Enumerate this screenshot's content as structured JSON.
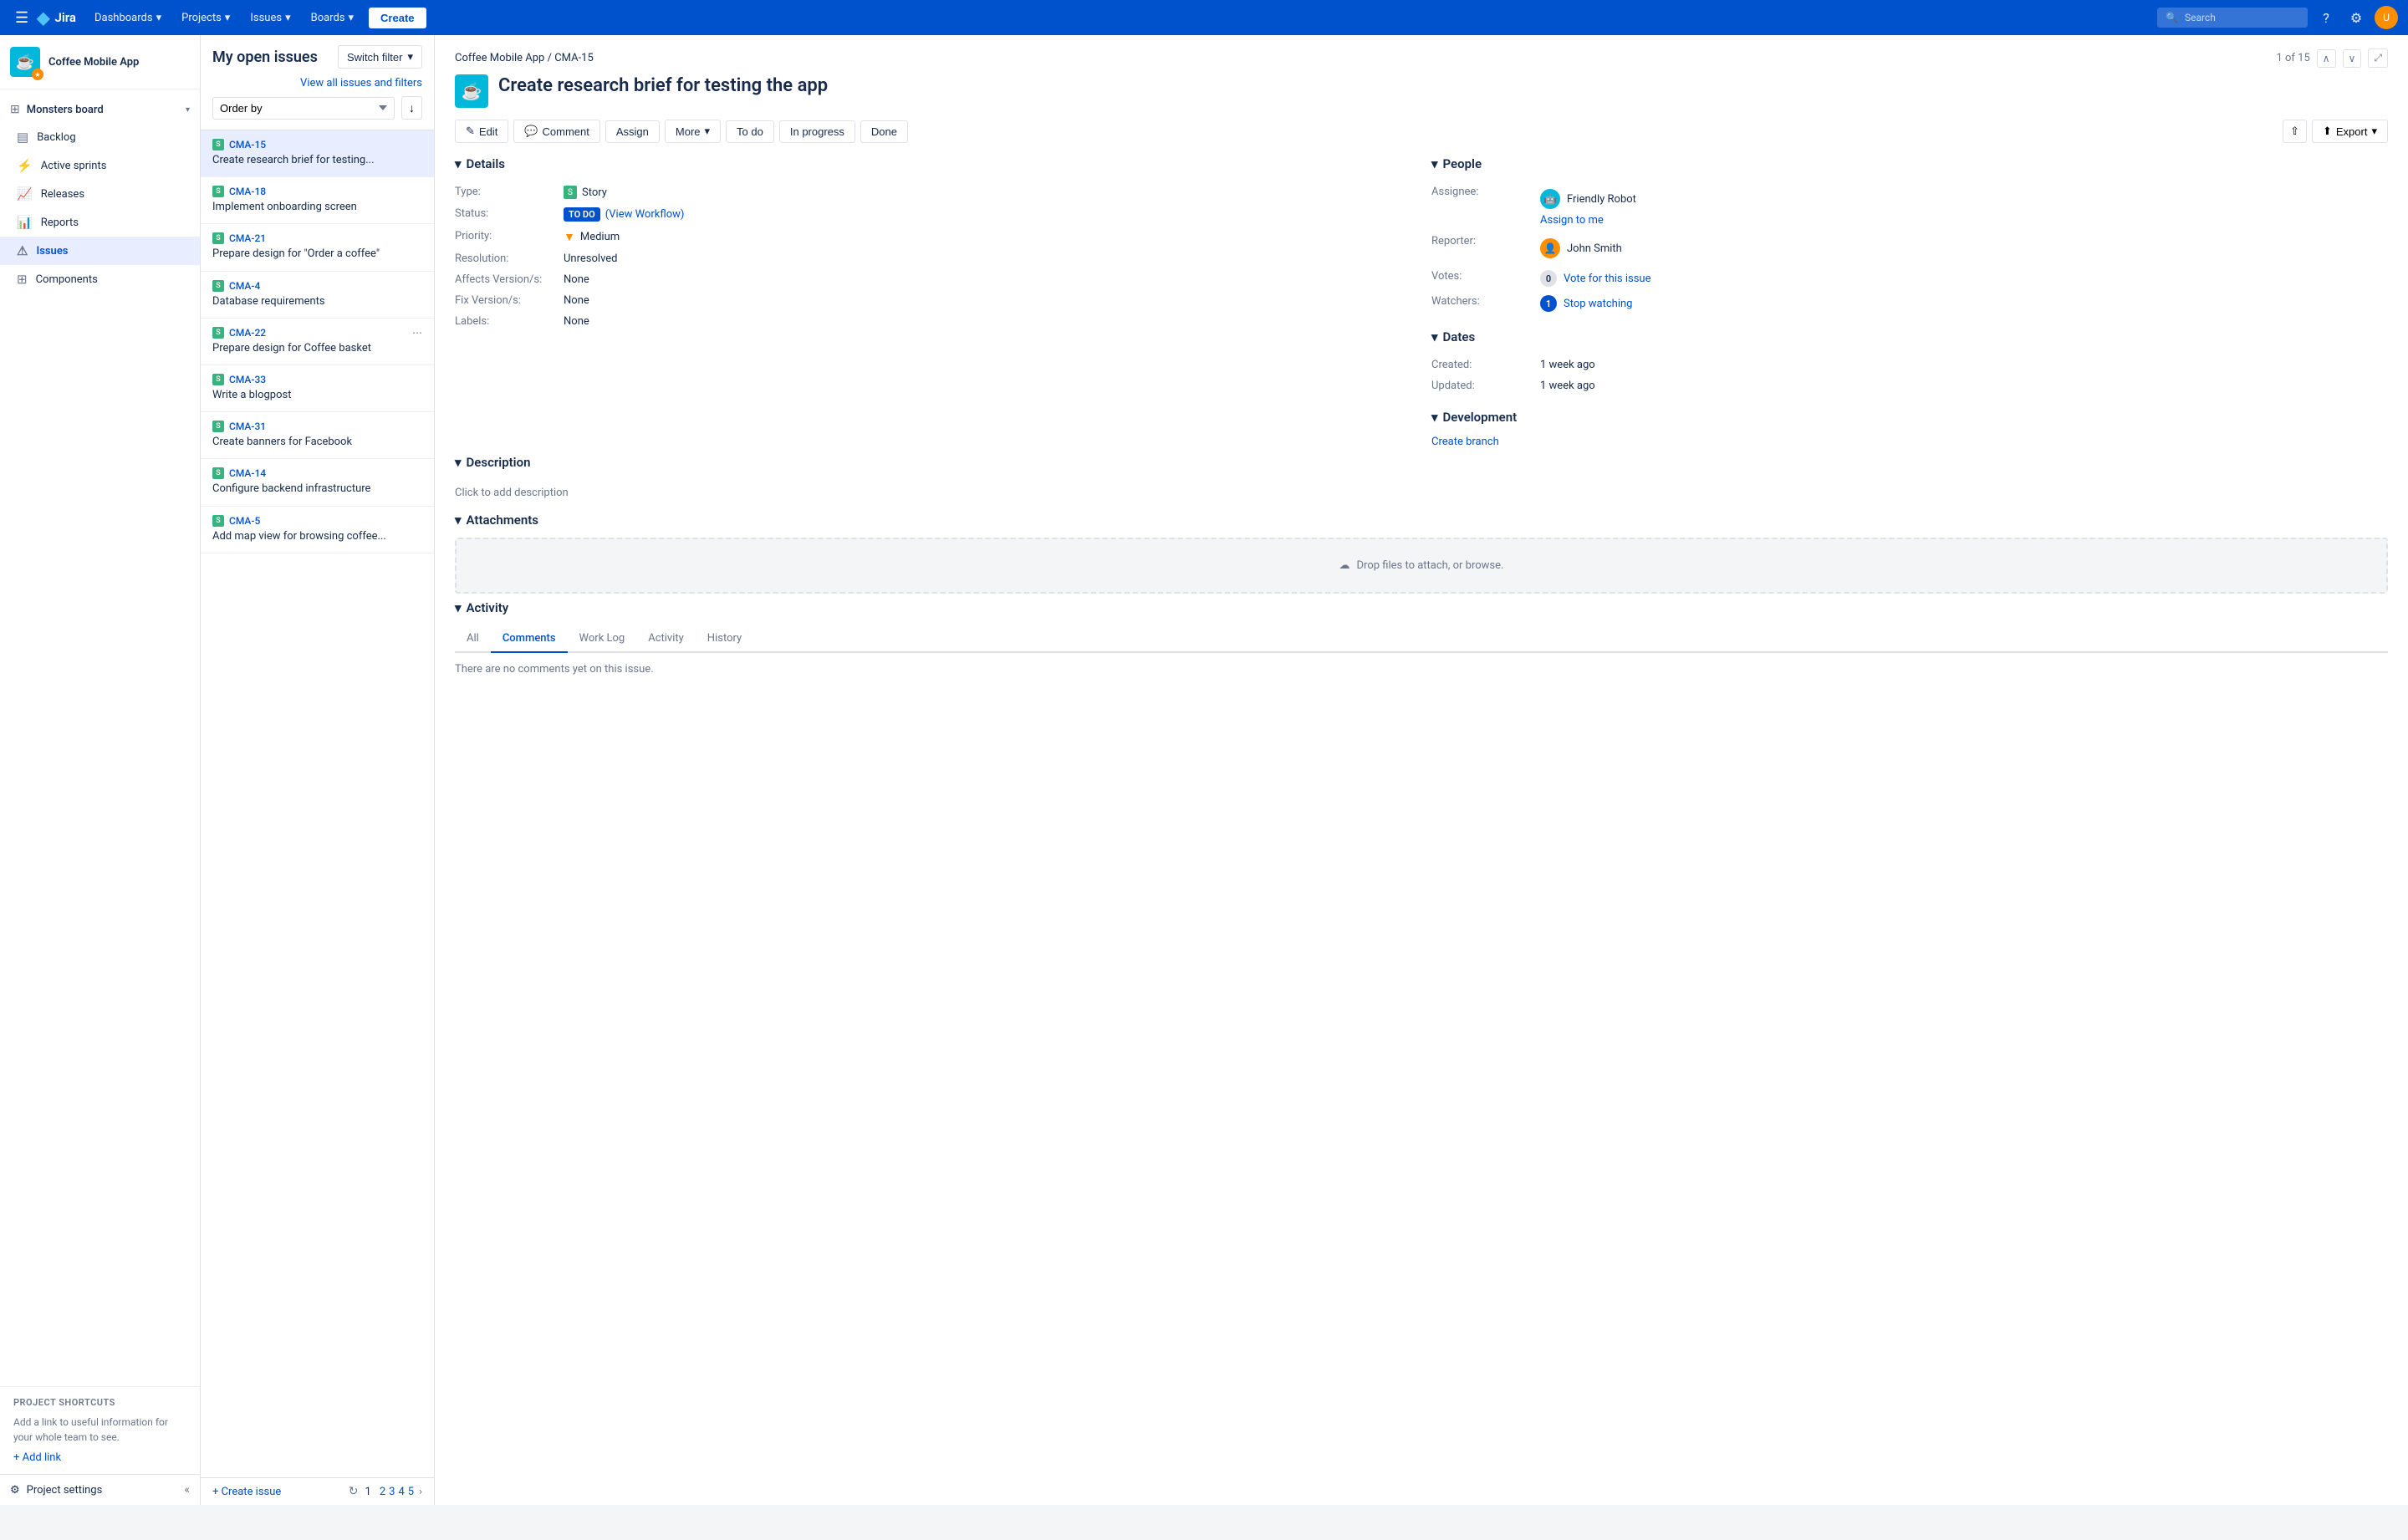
{
  "topNav": {
    "logoText": "Jira",
    "hamburger": "☰",
    "items": [
      {
        "label": "Dashboards",
        "id": "dashboards"
      },
      {
        "label": "Projects",
        "id": "projects"
      },
      {
        "label": "Issues",
        "id": "issues"
      },
      {
        "label": "Boards",
        "id": "boards"
      }
    ],
    "createLabel": "Create",
    "searchPlaceholder": "Search",
    "helpIcon": "?",
    "settingsIcon": "⚙"
  },
  "sidebar": {
    "projectName": "Coffee Mobile App",
    "boardsLabel": "Monsters board",
    "navItems": [
      {
        "label": "Backlog",
        "icon": "▤",
        "id": "backlog",
        "active": false
      },
      {
        "label": "Active sprints",
        "icon": "⚡",
        "id": "active-sprints",
        "active": false
      },
      {
        "label": "Releases",
        "icon": "📈",
        "id": "releases",
        "active": false
      },
      {
        "label": "Reports",
        "icon": "📊",
        "id": "reports",
        "active": false
      },
      {
        "label": "Issues",
        "icon": "⚠",
        "id": "issues",
        "active": true
      },
      {
        "label": "Components",
        "icon": "⊞",
        "id": "components",
        "active": false
      }
    ],
    "shortcutsTitle": "PROJECT SHORTCUTS",
    "shortcutsDesc": "Add a link to useful information for your whole team to see.",
    "addLinkLabel": "+ Add link",
    "projectSettingsLabel": "Project settings",
    "collapseIcon": "«"
  },
  "issuesList": {
    "pageTitle": "My open issues",
    "switchFilterLabel": "Switch filter",
    "viewAllLabel": "View all issues and filters",
    "orderByLabel": "Order by",
    "issues": [
      {
        "id": "CMA-15",
        "title": "Create research brief for testing...",
        "selected": true
      },
      {
        "id": "CMA-18",
        "title": "Implement onboarding screen",
        "selected": false
      },
      {
        "id": "CMA-21",
        "title": "Prepare design for \"Order a coffee\"",
        "selected": false
      },
      {
        "id": "CMA-4",
        "title": "Database requirements",
        "selected": false
      },
      {
        "id": "CMA-22",
        "title": "Prepare design for Coffee basket",
        "selected": false,
        "hasMore": true
      },
      {
        "id": "CMA-33",
        "title": "Write a blogpost",
        "selected": false
      },
      {
        "id": "CMA-31",
        "title": "Create banners for Facebook",
        "selected": false
      },
      {
        "id": "CMA-14",
        "title": "Configure backend infrastructure",
        "selected": false
      },
      {
        "id": "CMA-5",
        "title": "Add map view for browsing coffee...",
        "selected": false
      }
    ],
    "createIssueLabel": "+ Create issue",
    "pagination": {
      "current": "1",
      "pages": [
        "2",
        "3",
        "4",
        "5"
      ],
      "nextArrow": "›"
    },
    "refreshIcon": "↻"
  },
  "issueDetail": {
    "breadcrumb": "Coffee Mobile App / CMA-15",
    "breadcrumbProject": "Coffee Mobile App",
    "breadcrumbSep": " / ",
    "breadcrumbId": "CMA-15",
    "navCount": "1 of 15",
    "title": "Create research brief for testing the app",
    "actions": {
      "edit": "Edit",
      "comment": "Comment",
      "assign": "Assign",
      "more": "More",
      "todo": "To do",
      "inProgress": "In progress",
      "done": "Done",
      "share": "⇧",
      "export": "Export"
    },
    "details": {
      "sectionTitle": "Details",
      "type": "Story",
      "status": "TO DO",
      "statusSub": "(View Workflow)",
      "priority": "Medium",
      "resolution": "Unresolved",
      "affectsVersions": "None",
      "fixVersions": "None",
      "labels": "None"
    },
    "people": {
      "sectionTitle": "People",
      "assigneeLabel": "Assignee:",
      "assigneeName": "Friendly Robot",
      "assignToMeLabel": "Assign to me",
      "reporterLabel": "Reporter:",
      "reporterName": "John Smith",
      "votesLabel": "Votes:",
      "votesCount": "0",
      "voteLink": "Vote for this issue",
      "watchersLabel": "Watchers:",
      "watchersCount": "1",
      "watchLink": "Stop watching"
    },
    "description": {
      "sectionTitle": "Description",
      "placeholder": "Click to add description"
    },
    "attachments": {
      "sectionTitle": "Attachments",
      "dropZoneText": "Drop files to attach, or browse."
    },
    "dates": {
      "sectionTitle": "Dates",
      "createdLabel": "Created:",
      "createdValue": "1 week ago",
      "updatedLabel": "Updated:",
      "updatedValue": "1 week ago"
    },
    "development": {
      "sectionTitle": "Development",
      "createBranchLink": "Create branch"
    },
    "activity": {
      "sectionTitle": "Activity",
      "tabs": [
        "All",
        "Comments",
        "Work Log",
        "Activity",
        "History"
      ],
      "activeTab": "Comments",
      "noCommentsText": "There are no comments yet on this issue."
    }
  }
}
